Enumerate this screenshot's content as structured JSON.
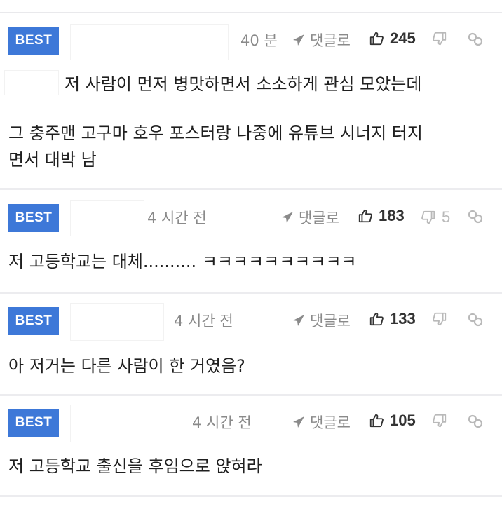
{
  "comments": [
    {
      "badge": "BEST",
      "time": "40 분",
      "reply_label": "댓글로",
      "likes": "245",
      "dislikes": "",
      "lines": [
        "저 사람이 먼저 병맛하면서 소소하게 관심 모았는데",
        "그 충주맨 고구마 호우 포스터랑 나중에 유튜브 시너지 터지",
        "면서 대박 남"
      ]
    },
    {
      "badge": "BEST",
      "time": "4 시간 전",
      "reply_label": "댓글로",
      "likes": "183",
      "dislikes": "5",
      "lines": [
        "저 고등학교는 대체.......... ㅋㅋㅋㅋㅋㅋㅋㅋㅋㅋ"
      ]
    },
    {
      "badge": "BEST",
      "time": "4 시간 전",
      "reply_label": "댓글로",
      "likes": "133",
      "dislikes": "",
      "lines": [
        "아 저거는 다른 사람이 한 거였음?"
      ]
    },
    {
      "badge": "BEST",
      "time": "4 시간 전",
      "reply_label": "댓글로",
      "likes": "105",
      "dislikes": "",
      "lines": [
        "저 고등학교 출신을 후임으로 앉혀라"
      ]
    }
  ],
  "icons": {
    "reply": "reply-arrow-icon",
    "like": "thumbs-up-icon",
    "dislike": "thumbs-down-icon",
    "link": "link-icon"
  },
  "colors": {
    "best_badge": "#3d78d8",
    "meta_text": "#8a8a8a",
    "divider": "#ececef"
  }
}
